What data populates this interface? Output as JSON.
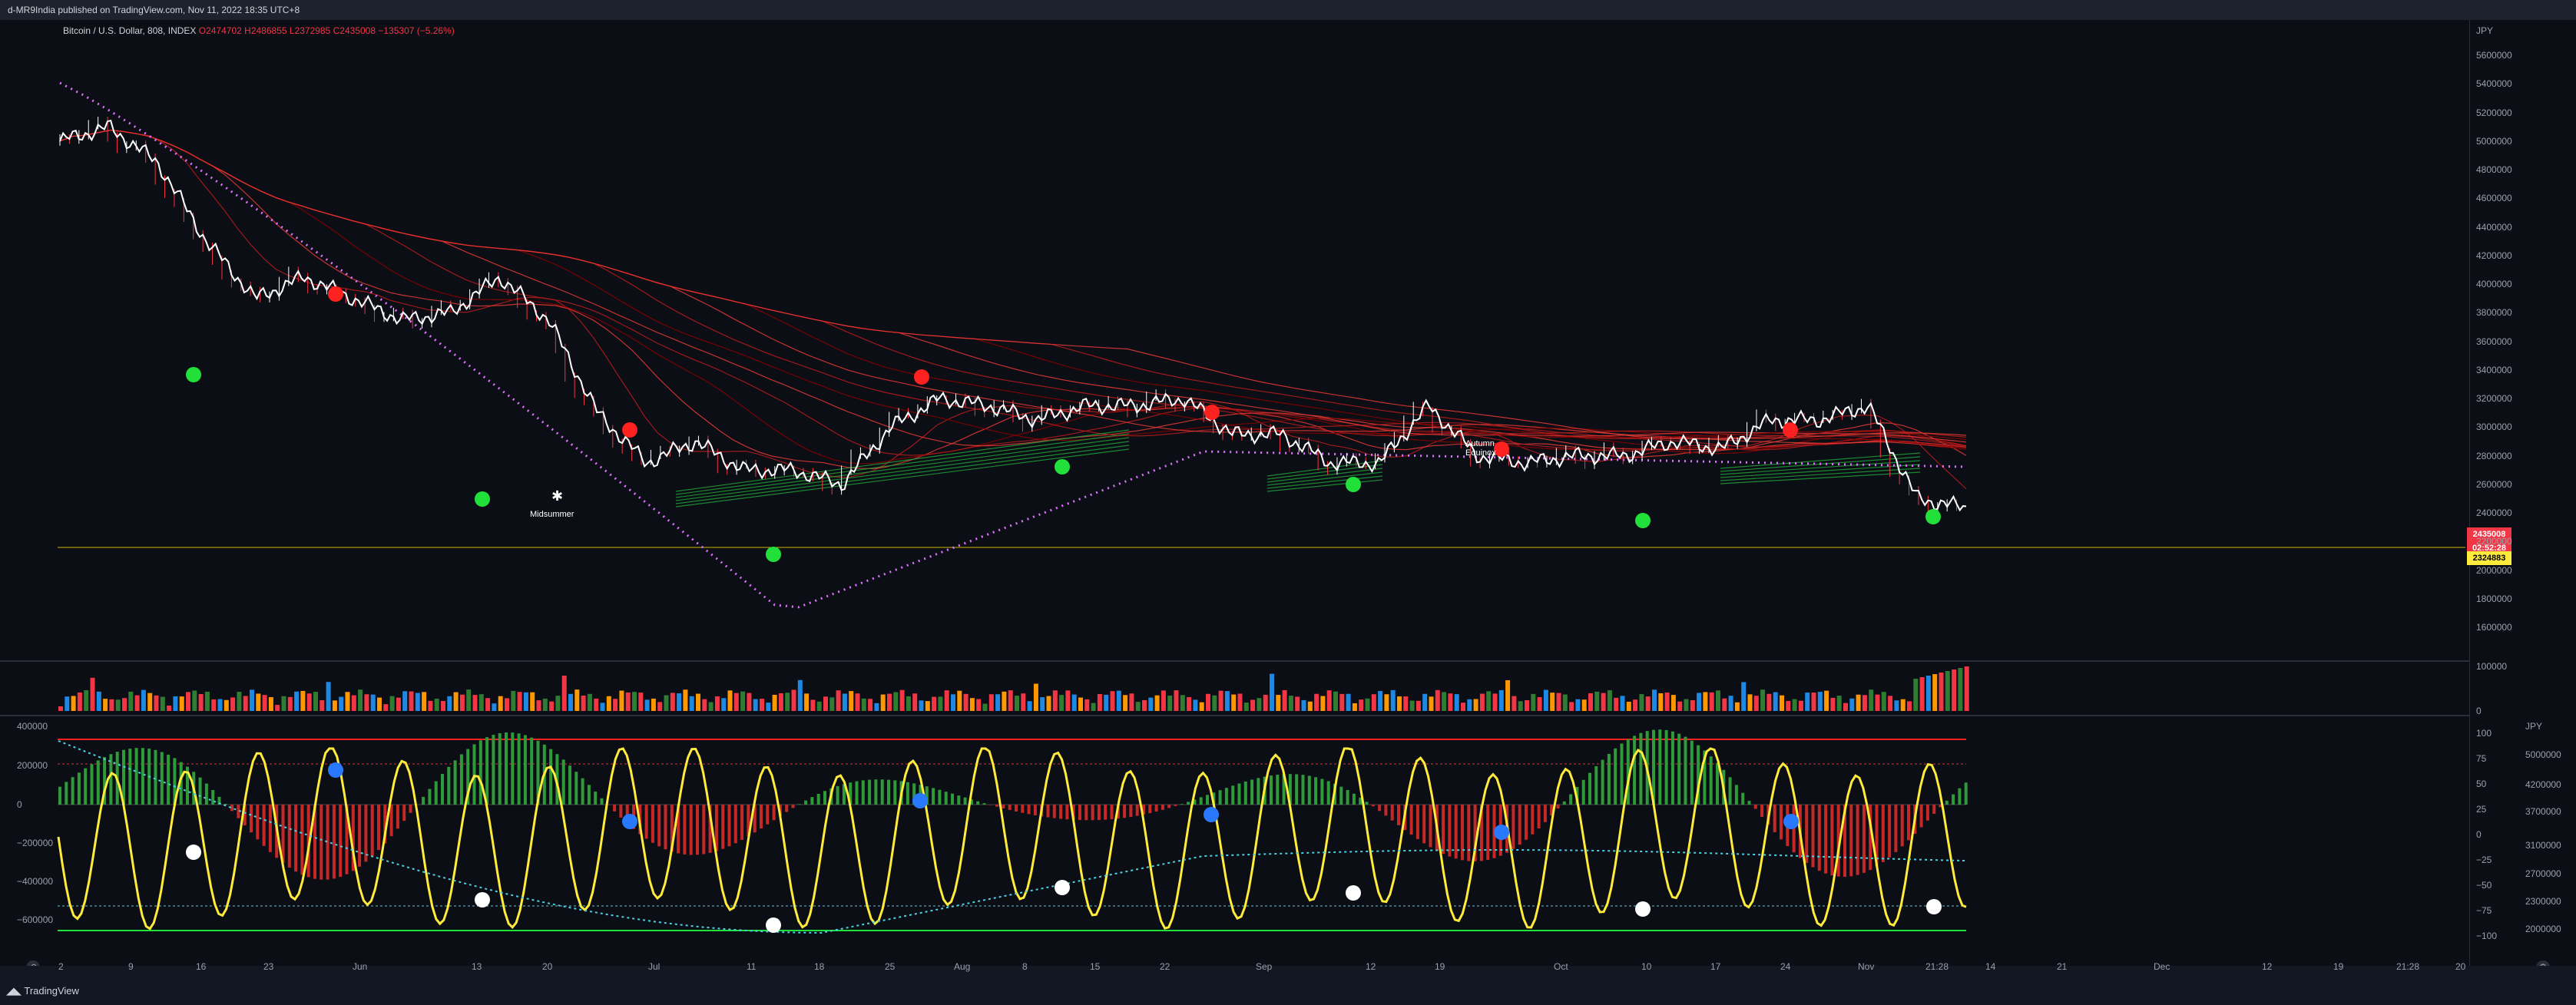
{
  "header": {
    "published": "d-MR9India published on TradingView.com, Nov 11, 2022 18:35 UTC+8"
  },
  "legend": {
    "symbol": "Bitcoin / U.S. Dollar, 808, INDEX",
    "o": "O2474702",
    "h": "H2486855",
    "l": "L2372985",
    "c": "C2435008",
    "change": "−135307 (−5.26%)"
  },
  "price_axis": {
    "currency": "JPY",
    "ticks": [
      "5600000",
      "5400000",
      "5200000",
      "5000000",
      "4800000",
      "4600000",
      "4400000",
      "4200000",
      "4000000",
      "3800000",
      "3600000",
      "3400000",
      "3200000",
      "3000000",
      "2800000",
      "2600000",
      "2400000",
      "2200000",
      "2000000",
      "1800000",
      "1600000"
    ],
    "last_price": "2435008",
    "countdown": "02:52:28",
    "line_price": "2324883"
  },
  "volume_axis": {
    "ticks": [
      "100000",
      "0"
    ]
  },
  "osc_left_axis": {
    "ticks": [
      "400000",
      "200000",
      "0",
      "−200000",
      "−400000",
      "−600000"
    ]
  },
  "osc_right_axis": {
    "ticks": [
      "100",
      "75",
      "50",
      "25",
      "0",
      "−25",
      "−50",
      "−75",
      "−100"
    ]
  },
  "osc_price_axis": {
    "currency": "JPY",
    "ticks": [
      "5000000",
      "4200000",
      "3700000",
      "3100000",
      "2700000",
      "2300000",
      "2000000"
    ]
  },
  "time_axis": {
    "ticks": [
      "2",
      "9",
      "16",
      "23",
      "Jun",
      "13",
      "20",
      "Jul",
      "11",
      "18",
      "25",
      "Aug",
      "8",
      "15",
      "22",
      "Sep",
      "12",
      "19",
      "Oct",
      "10",
      "17",
      "24",
      "Nov",
      "21:28",
      "14",
      "21",
      "Dec",
      "12",
      "19",
      "21:28",
      "20"
    ]
  },
  "annotations": {
    "midsummer": "Midsummer",
    "autumn1": "Autumn",
    "autumn2": "Equinox"
  },
  "footer": {
    "brand": "TradingView"
  },
  "colors": {
    "up": "#22ab94",
    "down": "#f23645",
    "signal_red": "#ff2020",
    "signal_green": "#22e03a",
    "yellow": "#ffeb3b",
    "cyan": "#4dd0e1",
    "magenta": "#e070ff"
  },
  "chart_data": {
    "type": "line",
    "main_price_jpy": [
      5000000,
      5100000,
      4850000,
      4300000,
      3900000,
      4050000,
      3900000,
      3750000,
      3800000,
      4050000,
      3750000,
      3100000,
      2750000,
      2900000,
      2700000,
      2700000,
      2600000,
      3000000,
      3200000,
      3150000,
      3050000,
      3150000,
      3150000,
      3200000,
      2950000,
      2950000,
      2750000,
      2750000,
      3150000,
      2800000,
      2750000,
      2800000,
      2800000,
      2900000,
      2850000,
      3050000,
      3050000,
      3150000,
      2500000,
      2435008
    ],
    "signal_dots": {
      "red": [
        "May 29",
        "Jun 23",
        "Jul 24",
        "Aug 19",
        "Sep 21",
        "Oct 25"
      ],
      "green": [
        "May 16",
        "Jun 13",
        "Jul 11",
        "Aug 8",
        "Sep 5",
        "Oct 7",
        "Nov 7"
      ]
    }
  }
}
